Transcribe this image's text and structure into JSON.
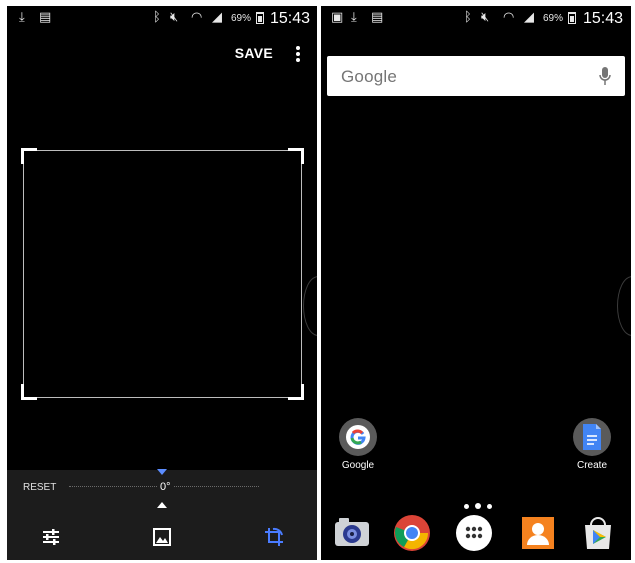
{
  "left_screen": {
    "status_bar": {
      "left_icons": [
        "download-icon",
        "document-icon"
      ],
      "right_icons": [
        "bluetooth-icon",
        "mute-icon",
        "wifi-icon",
        "signal-icon"
      ],
      "battery": "69%",
      "time": "15:43"
    },
    "toolbar": {
      "save_label": "SAVE",
      "more_icon": "more-vert-icon"
    },
    "straighten": {
      "reset_label": "RESET",
      "angle": "0°"
    },
    "tools": [
      {
        "name": "tune-icon"
      },
      {
        "name": "image-icon"
      },
      {
        "name": "crop-rotate-icon",
        "active_color": "#4a7cff"
      }
    ]
  },
  "right_screen": {
    "status_bar": {
      "left_icons": [
        "image-icon",
        "download-icon",
        "document-icon"
      ],
      "right_icons": [
        "bluetooth-icon",
        "mute-icon",
        "wifi-icon",
        "signal-icon"
      ],
      "battery": "69%",
      "time": "15:43"
    },
    "search": {
      "logo": "Google",
      "mic_icon": "mic-icon"
    },
    "home_apps": [
      {
        "label": "Google",
        "icon": "google-app-icon"
      },
      {
        "label": "Create",
        "icon": "docs-create-icon"
      }
    ],
    "dock": [
      {
        "icon": "camera-icon"
      },
      {
        "icon": "chrome-icon"
      },
      {
        "icon": "app-drawer-icon"
      },
      {
        "icon": "contacts-icon"
      },
      {
        "icon": "play-store-icon"
      }
    ]
  }
}
